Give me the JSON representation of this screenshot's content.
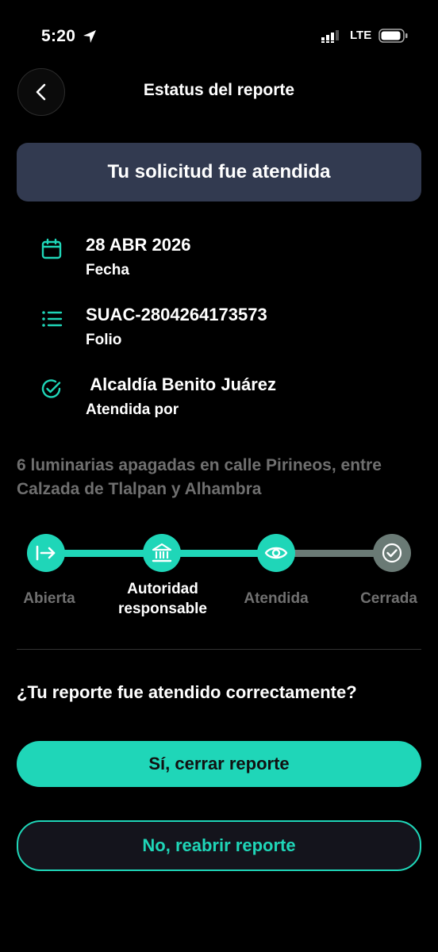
{
  "status_bar": {
    "time": "5:20",
    "network": "LTE",
    "location_icon": "location-arrow-icon",
    "signal_icon": "signal-bars-icon",
    "battery_icon": "battery-icon"
  },
  "header": {
    "back_icon": "chevron-left-icon",
    "title": "Estatus del reporte"
  },
  "banner": {
    "text": "Tu solicitud fue atendida"
  },
  "details": [
    {
      "icon": "calendar-icon",
      "value": "28 ABR 2026",
      "label": "Fecha"
    },
    {
      "icon": "list-icon",
      "value": "SUAC-2804264173573",
      "label": "Folio"
    },
    {
      "icon": "check-circle-icon",
      "value": " Alcaldía Benito Juárez",
      "label": "Atendida por"
    }
  ],
  "description": "6 luminarias apagadas en calle Pirineos, entre Calzada de Tlalpan y Alhambra",
  "progress": {
    "current_step": 3,
    "steps": [
      {
        "label": "Abierta",
        "icon": "arrow-right-bar-icon",
        "state": "done"
      },
      {
        "label": "Autoridad responsable",
        "icon": "bank-building-icon",
        "state": "done"
      },
      {
        "label": "Atendida",
        "icon": "eye-icon",
        "state": "current"
      },
      {
        "label": "Cerrada",
        "icon": "check-circle-icon",
        "state": "pending"
      }
    ]
  },
  "question": "¿Tu reporte fue atendido correctamente?",
  "actions": {
    "close_label": "Sí, cerrar reporte",
    "reopen_label": "No, reabrir reporte"
  },
  "colors": {
    "accent": "#1fd6b8",
    "banner_bg": "#323a50",
    "inactive": "#6a7a75",
    "background": "#000000"
  }
}
